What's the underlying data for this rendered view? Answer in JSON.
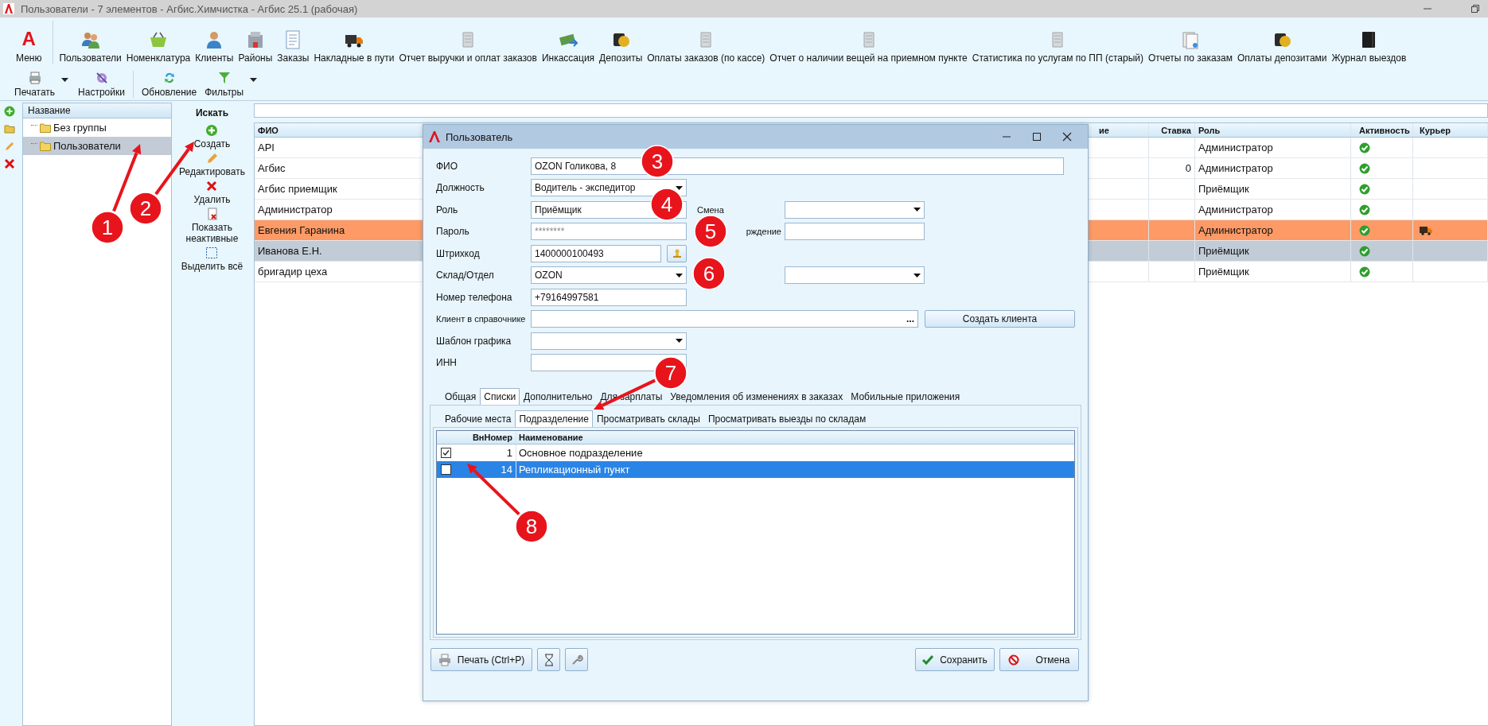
{
  "window": {
    "title": "Пользователи - 7 элементов - Агбис.Химчистка - Агбис 25.1 (рабочая)"
  },
  "ribbon": {
    "menu": {
      "logo": "A",
      "label": "Меню"
    },
    "items": [
      "Пользователи",
      "Номенклатура",
      "Клиенты",
      "Районы",
      "Заказы",
      "Накладные в пути",
      "Отчет выручки и оплат заказов",
      "Инкассация",
      "Депозиты",
      "Оплаты заказов (по кассе)",
      "Отчет о наличии вещей на приемном пункте",
      "Статистика по услугам по ПП (старый)",
      "Отчеты по заказам",
      "Оплаты депозитами",
      "Журнал выездов"
    ]
  },
  "toolbar": [
    {
      "label": "Печатать",
      "dropdown": true
    },
    {
      "label": "Настройки",
      "dropdown": false
    },
    {
      "label": "Обновление",
      "dropdown": false
    },
    {
      "label": "Фильтры",
      "dropdown": true
    }
  ],
  "tree": {
    "header": "Название",
    "items": [
      {
        "label": "Без группы",
        "selected": false
      },
      {
        "label": "Пользователи",
        "selected": true
      }
    ]
  },
  "actions": {
    "title": "Искать",
    "items": [
      "Создать",
      "Редактировать",
      "Удалить",
      "Показать неактивные",
      "Выделить всё"
    ]
  },
  "table": {
    "columns": [
      "ФИО",
      "ие",
      "Ставка",
      "Роль",
      "Активность",
      "Курьер"
    ],
    "rows": [
      {
        "fio": "API",
        "role": "Администратор",
        "active": true,
        "courier": false,
        "selected": false,
        "highlighted": false
      },
      {
        "fio": "Агбис",
        "rate": "0",
        "role": "Администратор",
        "active": true,
        "courier": false,
        "selected": false,
        "highlighted": false
      },
      {
        "fio": "Агбис приемщик",
        "role": "Приёмщик",
        "active": true,
        "courier": false,
        "selected": false,
        "highlighted": false
      },
      {
        "fio": "Администратор",
        "role": "Администратор",
        "active": true,
        "courier": false,
        "selected": false,
        "highlighted": false
      },
      {
        "fio": "Евгения Гаранина",
        "role": "Администратор",
        "active": true,
        "courier": true,
        "selected": false,
        "highlighted": true
      },
      {
        "fio": "Иванова Е.Н.",
        "role": "Приёмщик",
        "active": true,
        "courier": false,
        "selected": true,
        "highlighted": false
      },
      {
        "fio": "бригадир цеха",
        "role": "Приёмщик",
        "active": true,
        "courier": false,
        "selected": false,
        "highlighted": false
      }
    ]
  },
  "dialog": {
    "title": "Пользователь",
    "fields": [
      {
        "label": "ФИО",
        "kind": "wide",
        "value": "OZON Голикова, 8"
      },
      {
        "label": "Должность",
        "kind": "combo",
        "value": "Водитель - экспедитор"
      },
      {
        "label": "Роль",
        "kind": "text",
        "value": "Приёмщик",
        "side": {
          "label": "Смена",
          "kind": "combo"
        }
      },
      {
        "label": "Пароль",
        "kind": "password",
        "value": "********",
        "side": {
          "label": "рждение",
          "kind": "text"
        }
      },
      {
        "label": "Штрихкод",
        "kind": "stamp",
        "value": "1400000100493"
      },
      {
        "label": "Склад/Отдел",
        "kind": "combo",
        "value": "OZON",
        "side": {
          "kind": "combo"
        }
      },
      {
        "label": "Номер телефона",
        "kind": "text",
        "value": "+79164997581"
      },
      {
        "label": "Клиент в справочнике",
        "kind": "lookup",
        "ellipsis": "...",
        "button": "Создать клиента"
      },
      {
        "label": "Шаблон графика",
        "kind": "combo"
      },
      {
        "label": "ИНН",
        "kind": "text"
      }
    ],
    "tabs": [
      {
        "label": "Общая",
        "selected": false
      },
      {
        "label": "Списки",
        "selected": true
      },
      {
        "label": "Дополнительно",
        "selected": false
      },
      {
        "label": "Для зарплаты",
        "selected": false
      },
      {
        "label": "Уведомления об изменениях в заказах",
        "selected": false
      },
      {
        "label": "Мобильные приложения",
        "selected": false
      }
    ],
    "subtabs": [
      {
        "label": "Рабочие места",
        "selected": false
      },
      {
        "label": "Подразделение",
        "selected": true
      },
      {
        "label": "Просматривать склады",
        "selected": false
      },
      {
        "label": "Просматривать выезды по складам",
        "selected": false
      }
    ],
    "grid": {
      "columns": [
        "ВнНомер",
        "Наименование"
      ],
      "rows": [
        {
          "checked": true,
          "number": "1",
          "name": "Основное подразделение",
          "selected": false
        },
        {
          "checked": false,
          "number": "14",
          "name": "Репликационный пункт",
          "selected": true
        }
      ]
    },
    "buttons": {
      "print": "Печать (Ctrl+P)",
      "save": "Сохранить",
      "cancel": "Отмена"
    }
  },
  "annotations": [
    {
      "number": "1",
      "arrow": true
    },
    {
      "number": "2",
      "arrow": true
    },
    {
      "number": "3",
      "arrow": false
    },
    {
      "number": "4",
      "arrow": false
    },
    {
      "number": "5",
      "arrow": false
    },
    {
      "number": "6",
      "arrow": false
    },
    {
      "number": "7",
      "arrow": true
    },
    {
      "number": "8",
      "arrow": true
    }
  ]
}
